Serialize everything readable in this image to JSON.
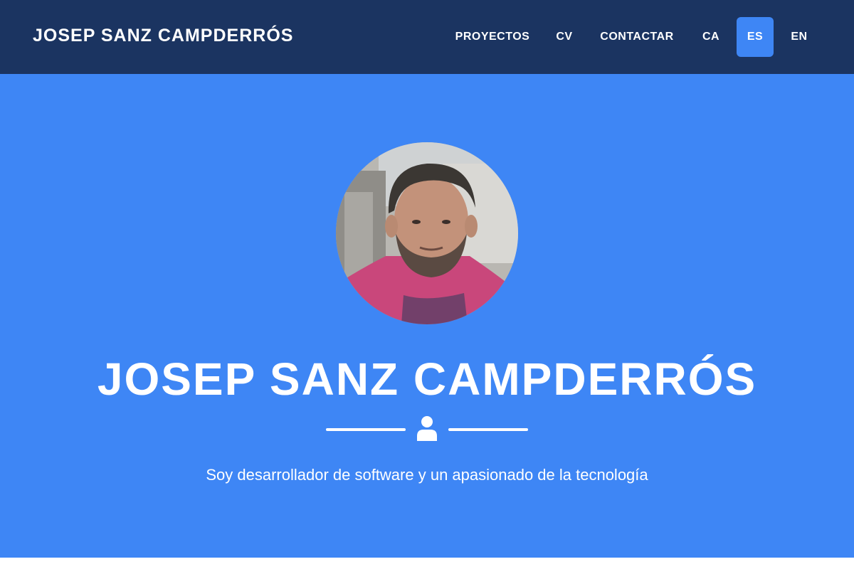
{
  "navbar": {
    "brand": "JOSEP SANZ CAMPDERRÓS",
    "links": [
      {
        "label": "PROYECTOS"
      },
      {
        "label": "CV"
      },
      {
        "label": "CONTACTAR"
      }
    ],
    "languages": [
      {
        "label": "CA",
        "active": false
      },
      {
        "label": "ES",
        "active": true
      },
      {
        "label": "EN",
        "active": false
      }
    ]
  },
  "hero": {
    "title": "JOSEP SANZ CAMPDERRÓS",
    "subtitle": "Soy desarrollador de software y un apasionado de la tecnología",
    "divider_icon": "user-icon"
  },
  "colors": {
    "navbar_bg": "#1b3461",
    "hero_bg": "#3e86f5",
    "active_bg": "#3e86f5",
    "text": "#ffffff"
  }
}
